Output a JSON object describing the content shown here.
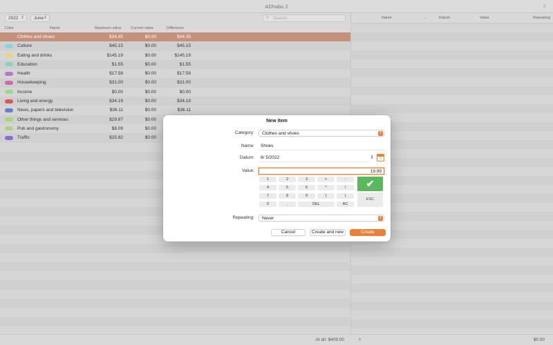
{
  "window": {
    "title": "ADhabu 2"
  },
  "toolbar": {
    "year": "2022",
    "month": "June",
    "search_placeholder": "Search"
  },
  "table": {
    "columns": [
      "Color",
      "Name",
      "Maximum value",
      "Current value",
      "Difference"
    ],
    "rows": [
      {
        "color": "#d98c6c",
        "name": "Clothes and shoes",
        "max": "$34.35",
        "current": "$0.00",
        "diff": "$34.35",
        "selected": true
      },
      {
        "color": "#8ecfe0",
        "name": "Culture",
        "max": "$45.15",
        "current": "$0.00",
        "diff": "$45.15"
      },
      {
        "color": "#e2d77a",
        "name": "Eating and drinks",
        "max": "$145.19",
        "current": "$0.00",
        "diff": "$145.19"
      },
      {
        "color": "#8ed4b4",
        "name": "Education",
        "max": "$1.55",
        "current": "$0.00",
        "diff": "$1.55"
      },
      {
        "color": "#b678cc",
        "name": "Health",
        "max": "$17.58",
        "current": "$0.00",
        "diff": "$17.58"
      },
      {
        "color": "#d26aa6",
        "name": "Housekeeping",
        "max": "$31.00",
        "current": "$0.00",
        "diff": "$31.00"
      },
      {
        "color": "#9ed88c",
        "name": "Income",
        "max": "$0.00",
        "current": "$0.00",
        "diff": "$0.00"
      },
      {
        "color": "#d45a5a",
        "name": "Living and energy",
        "max": "$34.19",
        "current": "$0.00",
        "diff": "$34.19"
      },
      {
        "color": "#6c7ed0",
        "name": "News, papers and television",
        "max": "$36.11",
        "current": "$0.00",
        "diff": "$36.11"
      },
      {
        "color": "#a6d67e",
        "name": "Other things and services",
        "max": "$29.97",
        "current": "$0.00",
        "diff": ""
      },
      {
        "color": "#a6d67e",
        "name": "Pub and gastronomy",
        "max": "$8.09",
        "current": "$0.00",
        "diff": ""
      },
      {
        "color": "#8a6ad4",
        "name": "Traffic",
        "max": "$25.82",
        "current": "$0.00",
        "diff": ""
      }
    ]
  },
  "right_panel": {
    "columns": [
      "Name",
      "Datum",
      "Value",
      "Repeating"
    ]
  },
  "footer": {
    "total": "At all: $409.00",
    "add_icon": "+",
    "right_total": "$0.00"
  },
  "dialog": {
    "title": "New item",
    "category_label": "Category:",
    "category_value": "Clothes and shoes",
    "name_label": "Name:",
    "name_value": "Shoes",
    "datum_label": "Datum:",
    "datum_value": "6/  5/2022",
    "calendar_day": "5",
    "value_label": "Value:",
    "value_value": "19.99",
    "keypad": [
      [
        "1",
        "2",
        "3",
        "+",
        "-"
      ],
      [
        "4",
        "5",
        "6",
        "*",
        "/"
      ],
      [
        "7",
        "8",
        "9",
        "(",
        ")"
      ],
      [
        "0",
        ".",
        "DEL",
        "AC"
      ]
    ],
    "ok_key": "✔",
    "esc_key": "ESC",
    "repeating_label": "Repeating:",
    "repeating_value": "Never",
    "cancel_button": "Cancel",
    "create_new_button": "Create and new",
    "create_button": "Create"
  }
}
